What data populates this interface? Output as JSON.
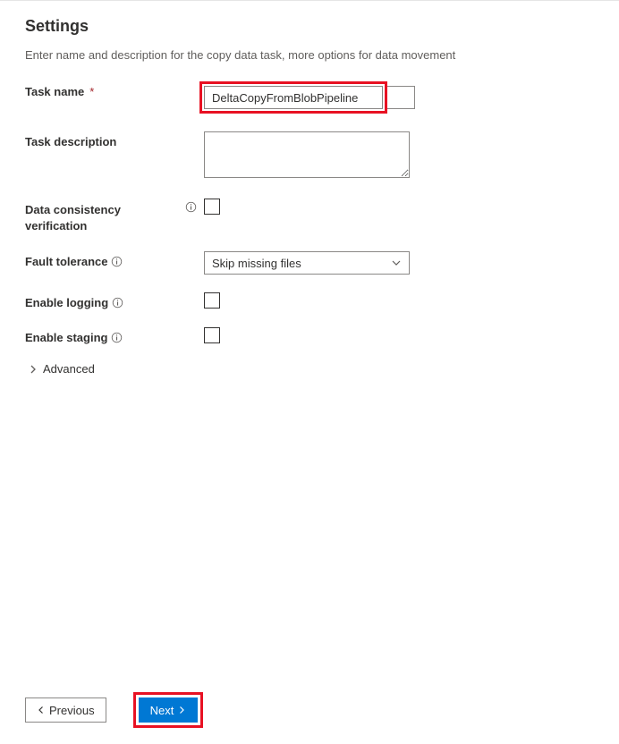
{
  "heading": "Settings",
  "subheading": "Enter name and description for the copy data task, more options for data movement",
  "fields": {
    "task_name": {
      "label": "Task name",
      "value": "DeltaCopyFromBlobPipeline"
    },
    "task_description": {
      "label": "Task description",
      "value": ""
    },
    "data_consistency": {
      "label_line1": "Data consistency",
      "label_line2": "verification",
      "checked": false
    },
    "fault_tolerance": {
      "label": "Fault tolerance",
      "selected": "Skip missing files"
    },
    "enable_logging": {
      "label": "Enable logging",
      "checked": false
    },
    "enable_staging": {
      "label": "Enable staging",
      "checked": false
    },
    "advanced": {
      "label": "Advanced"
    }
  },
  "footer": {
    "previous": "Previous",
    "next": "Next"
  }
}
